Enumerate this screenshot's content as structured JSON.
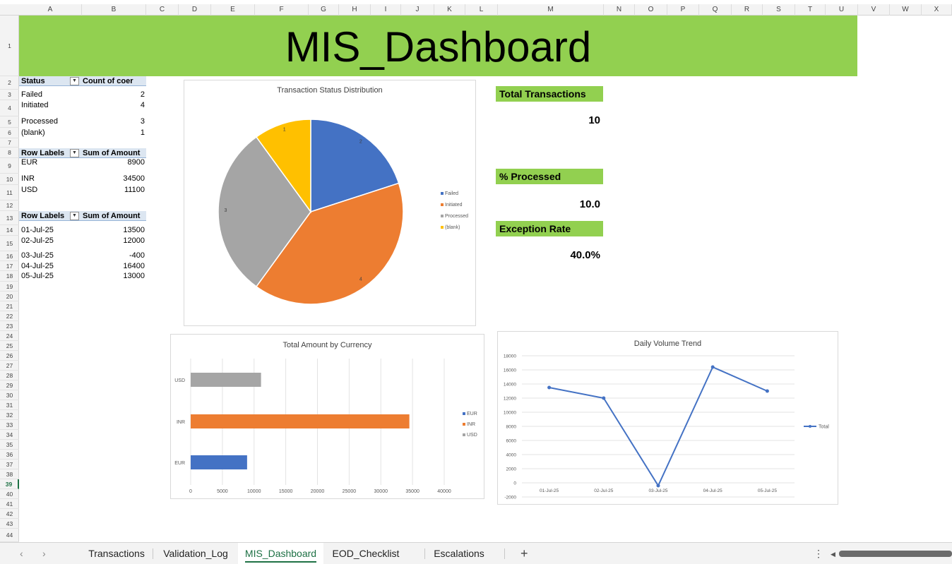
{
  "sheet": {
    "columns": [
      "A",
      "B",
      "C",
      "D",
      "E",
      "F",
      "G",
      "H",
      "I",
      "J",
      "K",
      "L",
      "M",
      "N",
      "O",
      "P",
      "Q",
      "R",
      "S",
      "T",
      "U",
      "V",
      "W",
      "X"
    ],
    "rows": [
      "1",
      "2",
      "3",
      "4",
      "5",
      "6",
      "7",
      "8",
      "9",
      "10",
      "11",
      "12",
      "13",
      "14",
      "15",
      "16",
      "17",
      "18",
      "19",
      "20",
      "21",
      "22",
      "23",
      "24",
      "25",
      "26",
      "27",
      "28",
      "29",
      "30",
      "31",
      "32",
      "33",
      "34",
      "35",
      "36",
      "37",
      "38",
      "39",
      "40",
      "41",
      "42",
      "43",
      "44"
    ],
    "selected_row": "39"
  },
  "banner": {
    "title": "MIS_Dashboard",
    "color": "#92d050"
  },
  "pivot_status": {
    "header_label": "Status",
    "header_value": "Count of coer",
    "rows": [
      {
        "label": "Failed",
        "value": "2"
      },
      {
        "label": "Initiated",
        "value": "4"
      },
      {
        "label": "Processed",
        "value": "3"
      },
      {
        "label": "(blank)",
        "value": "1"
      }
    ]
  },
  "pivot_currency": {
    "header_label": "Row Labels",
    "header_value": "Sum of Amount",
    "rows": [
      {
        "label": "EUR",
        "value": "8900"
      },
      {
        "label": "INR",
        "value": "34500"
      },
      {
        "label": "USD",
        "value": "11100"
      }
    ]
  },
  "pivot_date": {
    "header_label": "Row Labels",
    "header_value": "Sum of Amount",
    "rows": [
      {
        "label": "01-Jul-25",
        "value": "13500"
      },
      {
        "label": "02-Jul-25",
        "value": "12000"
      },
      {
        "label": "03-Jul-25",
        "value": "-400"
      },
      {
        "label": "04-Jul-25",
        "value": "16400"
      },
      {
        "label": "05-Jul-25",
        "value": "13000"
      }
    ]
  },
  "kpis": {
    "total_transactions_label": "Total Transactions",
    "total_transactions_value": "10",
    "pct_processed_label": "% Processed",
    "pct_processed_value": "10.0",
    "exception_rate_label": "Exception Rate",
    "exception_rate_value": "40.0%"
  },
  "chart_data": [
    {
      "type": "pie",
      "title": "Transaction Status Distribution",
      "categories": [
        "Failed",
        "Initiated",
        "Processed",
        "(blank)"
      ],
      "values": [
        2,
        4,
        3,
        1
      ],
      "colors": [
        "#4472c4",
        "#ed7d31",
        "#a5a5a5",
        "#ffc000"
      ],
      "legend": "right"
    },
    {
      "type": "bar",
      "orientation": "horizontal",
      "title": "Total Amount by Currency",
      "categories": [
        "EUR",
        "INR",
        "USD"
      ],
      "values": [
        8900,
        34500,
        11100
      ],
      "colors": [
        "#4472c4",
        "#ed7d31",
        "#a5a5a5"
      ],
      "xlim": [
        0,
        40000
      ],
      "ticks": [
        "0",
        "5000",
        "10000",
        "15000",
        "20000",
        "25000",
        "30000",
        "35000",
        "40000"
      ],
      "grid": true,
      "legend": "right"
    },
    {
      "type": "line",
      "title": "Daily Volume Trend",
      "categories": [
        "01-Jul-25",
        "02-Jul-25",
        "03-Jul-25",
        "04-Jul-25",
        "05-Jul-25"
      ],
      "series": [
        {
          "name": "Total",
          "values": [
            13500,
            12000,
            -400,
            16400,
            13000
          ],
          "color": "#4472c4"
        }
      ],
      "ylim": [
        -2000,
        18000
      ],
      "yticks": [
        "18000",
        "16000",
        "14000",
        "12000",
        "10000",
        "8000",
        "6000",
        "4000",
        "2000",
        "0",
        "-2000"
      ],
      "grid": true,
      "legend": "right"
    }
  ],
  "tabs": {
    "nav_prev": "‹",
    "nav_next": "›",
    "items": [
      "Transactions",
      "Validation_Log",
      "MIS_Dashboard",
      "EOD_Checklist",
      "Escalations"
    ],
    "active": "MIS_Dashboard",
    "add": "+",
    "more": "⋮",
    "scroll_left": "◀"
  }
}
